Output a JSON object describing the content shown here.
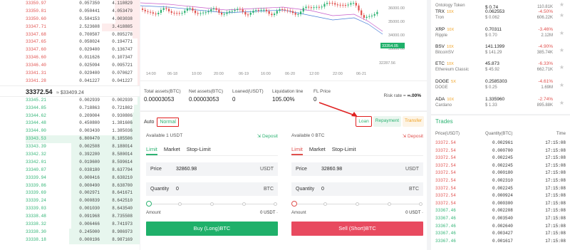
{
  "orderbook": {
    "asks": [
      {
        "price": "33350.97",
        "amount": "0.057350",
        "total": "4.110829",
        "depth": 0.22
      },
      {
        "price": "33350.81",
        "amount": "0.050441",
        "total": "4.053479",
        "depth": 0.22
      },
      {
        "price": "33350.60",
        "amount": "0.584153",
        "total": "4.003038",
        "depth": 0.21
      },
      {
        "price": "33347.71",
        "amount": "2.523608",
        "total": "3.418885",
        "depth": 0.33
      },
      {
        "price": "33347.68",
        "amount": "0.700507",
        "total": "0.895278",
        "depth": 0.06
      },
      {
        "price": "33347.65",
        "amount": "0.058024",
        "total": "0.194771",
        "depth": 0.02
      },
      {
        "price": "33347.60",
        "amount": "0.029400",
        "total": "0.136747",
        "depth": 0.02
      },
      {
        "price": "33346.60",
        "amount": "0.011626",
        "total": "0.107347",
        "depth": 0.02
      },
      {
        "price": "33346.40",
        "amount": "0.025094",
        "total": "0.095721",
        "depth": 0.02
      },
      {
        "price": "33341.31",
        "amount": "0.029400",
        "total": "0.070627",
        "depth": 0.02
      },
      {
        "price": "33341.28",
        "amount": "0.041227",
        "total": "0.041227",
        "depth": 0.02
      }
    ],
    "last_price": "33372.54",
    "last_usd": "≈ $33409.24",
    "bids": [
      {
        "price": "33345.21",
        "amount": "0.002939",
        "total": "0.002939",
        "depth": 0.02
      },
      {
        "price": "33344.85",
        "amount": "0.718863",
        "total": "0.721802",
        "depth": 0.05
      },
      {
        "price": "33344.62",
        "amount": "0.209004",
        "total": "0.930806",
        "depth": 0.06
      },
      {
        "price": "33344.48",
        "amount": "0.450800",
        "total": "1.381606",
        "depth": 0.08
      },
      {
        "price": "33344.00",
        "amount": "0.003430",
        "total": "1.385036",
        "depth": 0.08
      },
      {
        "price": "33343.53",
        "amount": "6.800470",
        "total": "8.185506",
        "depth": 1.0
      },
      {
        "price": "33343.39",
        "amount": "0.002508",
        "total": "8.188014",
        "depth": 0.6
      },
      {
        "price": "33342.32",
        "amount": "0.392200",
        "total": "8.580014",
        "depth": 0.6
      },
      {
        "price": "33342.01",
        "amount": "0.019600",
        "total": "8.599614",
        "depth": 0.6
      },
      {
        "price": "33340.87",
        "amount": "0.038180",
        "total": "8.637794",
        "depth": 0.6
      },
      {
        "price": "33339.94",
        "amount": "0.000416",
        "total": "8.638210",
        "depth": 0.6
      },
      {
        "price": "33339.86",
        "amount": "0.000490",
        "total": "8.638700",
        "depth": 0.6
      },
      {
        "price": "33339.69",
        "amount": "0.002971",
        "total": "8.641671",
        "depth": 0.6
      },
      {
        "price": "33339.24",
        "amount": "0.000839",
        "total": "8.642510",
        "depth": 0.6
      },
      {
        "price": "33339.03",
        "amount": "0.001030",
        "total": "8.643540",
        "depth": 0.6
      },
      {
        "price": "33338.48",
        "amount": "0.091968",
        "total": "8.735508",
        "depth": 0.6
      },
      {
        "price": "33338.32",
        "amount": "0.006466",
        "total": "8.741973",
        "depth": 0.6
      },
      {
        "price": "33338.30",
        "amount": "0.245000",
        "total": "8.986973",
        "depth": 0.62
      },
      {
        "price": "33338.18",
        "amount": "0.000196",
        "total": "8.987169",
        "depth": 0.62
      }
    ]
  },
  "chart": {
    "price_labels": [
      "36000.00",
      "35000.00",
      "34000.00",
      "33000.00"
    ],
    "current_tag": "33354.05",
    "low_tag": "32287.56",
    "time_labels": [
      "14:00",
      "06-18",
      "10:00",
      "20:00",
      "06-19",
      "16:00",
      "06-20",
      "12:00",
      "22:00",
      "06-21"
    ]
  },
  "account": {
    "total_label": "Total assets(BTC)",
    "total_value": "0.00003053",
    "net_label": "Net assets(BTC)",
    "net_value": "0.00003053",
    "loaned_label": "Loaned(USDT)",
    "loaned_value": "0",
    "liq_label": "Liquidation line",
    "liq_value": "105.00%",
    "fl_label": "FL Price",
    "fl_value": "0",
    "risk_label": "Risk rate",
    "risk_value": "∞.00%"
  },
  "form": {
    "auto": "Auto",
    "normal": "Normal",
    "loan": "Loan",
    "repayment": "Repayment",
    "transfer": "Transfer",
    "buy": {
      "available": "Available   1 USDT",
      "deposit": "Deposit",
      "tabs": [
        "Limit",
        "Market",
        "Stop-Limit"
      ],
      "price_label": "Price",
      "price_value": "32860.98",
      "price_unit": "USDT",
      "qty_label": "Quantity",
      "qty_value": "0",
      "qty_unit": "BTC",
      "amount_label": "Amount",
      "amount_value": "0 USDT  ·",
      "submit": "Buy (Long)BTC"
    },
    "sell": {
      "available": "Available   0 BTC",
      "deposit": "Deposit",
      "tabs": [
        "Limit",
        "Market",
        "Stop-Limit"
      ],
      "price_label": "Price",
      "price_value": "32860.98",
      "price_unit": "USDT",
      "qty_label": "Quantity",
      "qty_value": "0",
      "qty_unit": "BTC",
      "amount_label": "Amount",
      "amount_value": "0 USDT  ·",
      "submit": "Sell (Short)BTC"
    }
  },
  "tickers": [
    {
      "name": "",
      "lev": "",
      "price": "$ 0.74",
      "change": "",
      "sub": "Ontology Token",
      "sub_price": "",
      "vol": "110.81K",
      "change_color": "#e0504d"
    },
    {
      "name": "TRX",
      "lev": "10X",
      "price": "0.062553",
      "change": "-4.50%",
      "sub": "Tron",
      "sub_price": "$ 0.062",
      "vol": "606.22K",
      "change_color": "#e0504d"
    },
    {
      "name": "XRP",
      "lev": "10X",
      "price": "0.70311",
      "change": "-3.46%",
      "sub": "Ripple",
      "sub_price": "$ 0.70",
      "vol": "2.12M",
      "change_color": "#e0504d"
    },
    {
      "name": "BSV",
      "lev": "10X",
      "price": "141.1399",
      "change": "-4.90%",
      "sub": "BitcoinSV",
      "sub_price": "$ 141.29",
      "vol": "385.74K",
      "change_color": "#e0504d"
    },
    {
      "name": "ETC",
      "lev": "10X",
      "price": "45.873",
      "change": "-6.33%",
      "sub": "Ethereum Classic",
      "sub_price": "$ 45.92",
      "vol": "662.71K",
      "change_color": "#e0504d"
    },
    {
      "name": "DOGE",
      "lev": "5X",
      "price": "0.2585303",
      "change": "-4.61%",
      "sub": "DOGE",
      "sub_price": "$ 0.25",
      "vol": "1.69M",
      "change_color": "#e0504d"
    },
    {
      "name": "ADA",
      "lev": "10X",
      "price": "1.335960",
      "change": "-2.74%",
      "sub": "Cardano",
      "sub_price": "$ 1.33",
      "vol": "895.88K",
      "change_color": "#e0504d"
    }
  ],
  "trades": {
    "title": "Trades",
    "headers": [
      "Price(USDT)",
      "Quantity(BTC)",
      "Time"
    ],
    "rows": [
      {
        "p": "33372.54",
        "q": "0.002961",
        "t": "17:15:08",
        "side": "sell"
      },
      {
        "p": "33372.54",
        "q": "0.000700",
        "t": "17:15:08",
        "side": "sell"
      },
      {
        "p": "33372.54",
        "q": "0.002245",
        "t": "17:15:08",
        "side": "sell"
      },
      {
        "p": "33372.54",
        "q": "0.002245",
        "t": "17:15:08",
        "side": "sell"
      },
      {
        "p": "33372.54",
        "q": "0.000180",
        "t": "17:15:08",
        "side": "sell"
      },
      {
        "p": "33372.54",
        "q": "0.002310",
        "t": "17:15:08",
        "side": "sell"
      },
      {
        "p": "33372.54",
        "q": "0.002245",
        "t": "17:15:08",
        "side": "sell"
      },
      {
        "p": "33372.54",
        "q": "0.000924",
        "t": "17:15:08",
        "side": "sell"
      },
      {
        "p": "33372.54",
        "q": "0.000300",
        "t": "17:15:08",
        "side": "sell"
      },
      {
        "p": "33367.46",
        "q": "0.002208",
        "t": "17:15:08",
        "side": "buy"
      },
      {
        "p": "33367.46",
        "q": "0.003540",
        "t": "17:15:08",
        "side": "buy"
      },
      {
        "p": "33367.46",
        "q": "0.002640",
        "t": "17:15:08",
        "side": "buy"
      },
      {
        "p": "33367.46",
        "q": "0.003427",
        "t": "17:15:08",
        "side": "buy"
      },
      {
        "p": "33367.46",
        "q": "0.001617",
        "t": "17:15:08",
        "side": "buy"
      }
    ]
  },
  "colors": {
    "up": "#2eb373",
    "down": "#e0504d",
    "highlight": "#e02020"
  }
}
